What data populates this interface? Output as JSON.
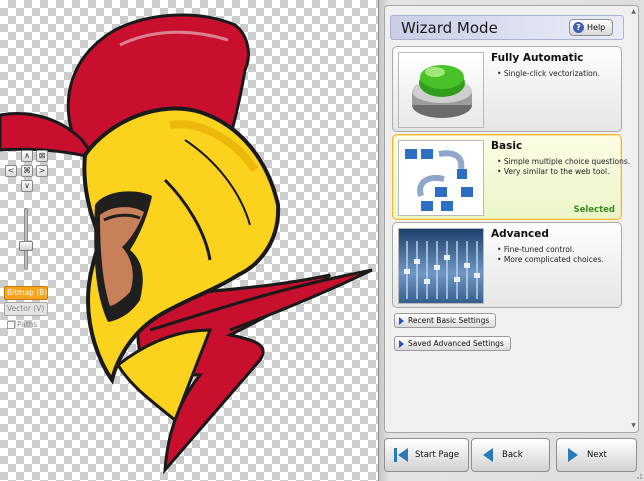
{
  "panel": {
    "title": "Wizard Mode",
    "help_label": "Help",
    "cards": [
      {
        "title": "Fully Automatic",
        "bullets": [
          "Single-click vectorization."
        ],
        "selected": false
      },
      {
        "title": "Basic",
        "bullets": [
          "Simple multiple choice questions.",
          "Very similar to the web tool."
        ],
        "selected": true,
        "selected_label": "Selected"
      },
      {
        "title": "Advanced",
        "bullets": [
          "Fine-tuned control.",
          "More complicated choices."
        ],
        "selected": false
      }
    ],
    "links": {
      "recent_basic": "Recent Basic Settings",
      "saved_advanced": "Saved Advanced Settings"
    }
  },
  "nav": {
    "start_page": "Start Page",
    "back": "Back",
    "next": "Next"
  },
  "left_tools": {
    "zoom_in": "∧",
    "zoom_out": "∨",
    "pan_left": "<",
    "pan_right": ">",
    "fit": "⌘",
    "full": "⊠",
    "zoom_level": 0.45,
    "modes": {
      "bitmap": "Bitmap (B)",
      "vector": "Vector (V)",
      "paths": "Paths"
    }
  },
  "colors": {
    "accent": "#f5a31b",
    "selected_border": "#f3b733",
    "selected_text": "#3d8a26",
    "header_bg": "#dfe2f2",
    "helmet_yellow": "#fbd21e",
    "crest_red": "#c8102e"
  }
}
